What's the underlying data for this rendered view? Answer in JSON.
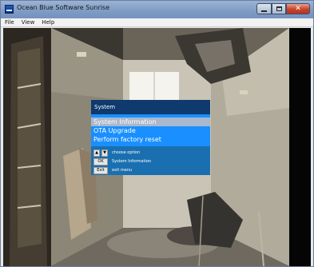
{
  "window": {
    "title": "Ocean Blue Software Sunrise"
  },
  "menubar": {
    "items": [
      "File",
      "View",
      "Help"
    ]
  },
  "osd": {
    "title": "System",
    "options": [
      {
        "label": "System Information",
        "selected": true
      },
      {
        "label": "OTA Upgrade",
        "selected": false
      },
      {
        "label": "Perform factory reset",
        "selected": false
      }
    ],
    "help": {
      "navigate_text": "choose option",
      "ok_key": "OK",
      "ok_text": "System Information",
      "exit_key": "Exit",
      "exit_text": "exit menu"
    }
  },
  "colors": {
    "osd_header": "#0e3a6e",
    "osd_list": "#1a8fff",
    "osd_selected": "#a9b8cc",
    "osd_help": "#1a6fb0"
  }
}
